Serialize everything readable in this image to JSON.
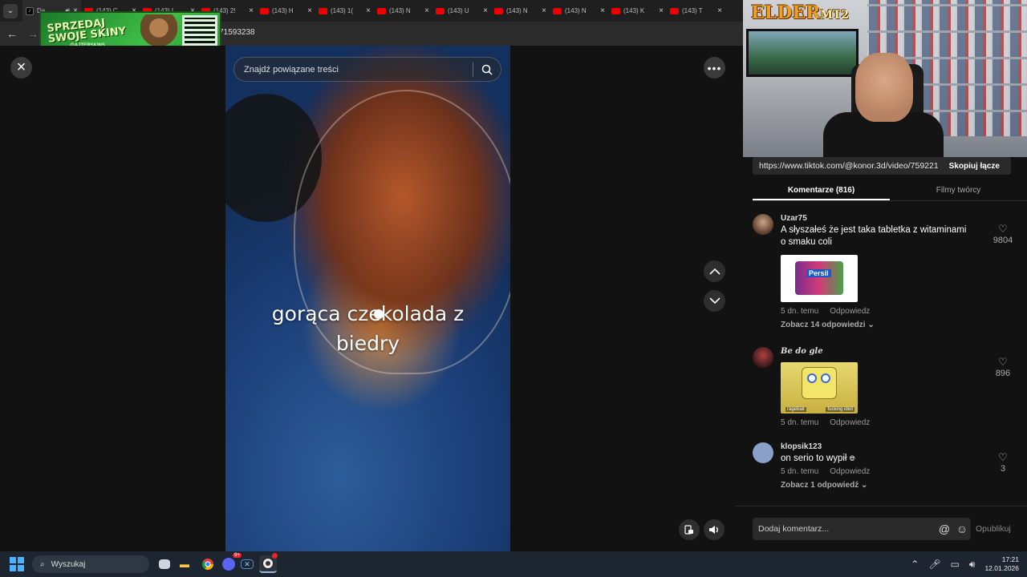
{
  "browser": {
    "tabs": [
      {
        "label": "Da",
        "active": true
      },
      {
        "label": "(143) C"
      },
      {
        "label": "(143) I"
      },
      {
        "label": "(143) 2!"
      },
      {
        "label": "(143) H"
      },
      {
        "label": "(143) 1("
      },
      {
        "label": "(143) N"
      },
      {
        "label": "(143) U"
      },
      {
        "label": "(143) N"
      },
      {
        "label": "(143) N"
      },
      {
        "label": "(143) K"
      },
      {
        "label": "(143) T"
      }
    ],
    "url_fragment": "0071593238"
  },
  "ad": {
    "headline": "SPRZEDAJ SWOJE SKINY",
    "handle": "@AJTERSKINS"
  },
  "viewer": {
    "search_placeholder": "Znajdź powiązane treści",
    "caption_line1": "gorąca czekolada z",
    "caption_line2": "biedry"
  },
  "webcam": {
    "logo_main": "ELDER",
    "logo_suffix": "MT2"
  },
  "panel": {
    "share_url": "https://www.tiktok.com/@konor.3d/video/7592217...",
    "copy_label": "Skopiuj łącze",
    "tab_comments": "Komentarze (816)",
    "tab_creator": "Filmy twórcy",
    "comments": [
      {
        "user": "Uzar75",
        "text": "A słyszałeś że jest taka tabletka z witaminami o smaku coli",
        "image_label": "Persil",
        "time": "5 dn. temu",
        "reply": "Odpowiedz",
        "replies": "Zobacz 14 odpowiedzi",
        "likes": "9804"
      },
      {
        "user": "Be do gle",
        "text": "",
        "image_caption_left": "ragebait",
        "image_caption_right": "fucking idiot",
        "time": "5 dn. temu",
        "reply": "Odpowiedz",
        "likes": "896"
      },
      {
        "user": "klopsik123",
        "text": "on serio to wypił",
        "time": "5 dn. temu",
        "reply": "Odpowiedz",
        "replies": "Zobacz 1 odpowiedź",
        "likes": "3"
      }
    ],
    "comment_placeholder": "Dodaj komentarz...",
    "publish_label": "Opublikuj"
  },
  "taskbar": {
    "search_label": "Wyszukaj",
    "discord_badge": "9+",
    "time": "17:21",
    "date": "12.01.2026"
  },
  "colors": {
    "accent_red": "#fe2c55",
    "panel_bg": "#121212",
    "taskbar_bg": "#1c2530"
  }
}
